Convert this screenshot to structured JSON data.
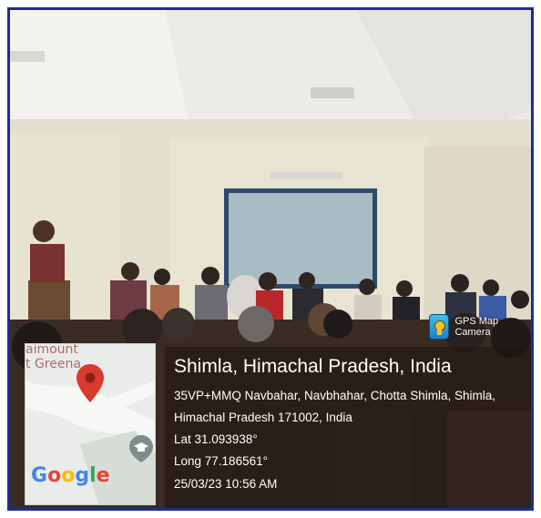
{
  "camera_badge": {
    "icon": "gps-map-camera-icon",
    "label": "GPS Map Camera"
  },
  "location": {
    "title": "Shimla, Himachal Pradesh, India",
    "address_line1": "35VP+MMQ Navbahar, Navbhahar, Chotta Shimla, Shimla,",
    "address_line2": "Himachal Pradesh 171002, India",
    "latitude": "Lat 31.093938°",
    "longitude": "Long 77.186561°",
    "datetime": "25/03/23 10:56 AM"
  },
  "map": {
    "label_top": "aimount",
    "label_second": "t Greena",
    "logo_text": "Google",
    "marker_icon": "map-pin-icon",
    "landmark_icon": "graduation-cap-icon"
  },
  "colors": {
    "frame_border": "#1d2f8f",
    "map_pin": "#d93a2b",
    "google_blue": "#4285f4",
    "google_red": "#ea4335",
    "google_yellow": "#fbbc05",
    "google_green": "#34a853"
  }
}
